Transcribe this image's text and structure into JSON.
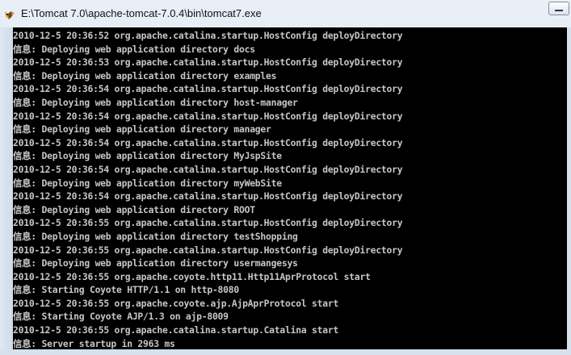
{
  "window": {
    "title": "E:\\Tomcat 7.0\\apache-tomcat-7.0.4\\bin\\tomcat7.exe",
    "icon": "tomcat-icon"
  },
  "console": {
    "lines": [
      "2010-12-5 20:36:52 org.apache.catalina.startup.HostConfig deployDirectory",
      "信息: Deploying web application directory docs",
      "2010-12-5 20:36:53 org.apache.catalina.startup.HostConfig deployDirectory",
      "信息: Deploying web application directory examples",
      "2010-12-5 20:36:54 org.apache.catalina.startup.HostConfig deployDirectory",
      "信息: Deploying web application directory host-manager",
      "2010-12-5 20:36:54 org.apache.catalina.startup.HostConfig deployDirectory",
      "信息: Deploying web application directory manager",
      "2010-12-5 20:36:54 org.apache.catalina.startup.HostConfig deployDirectory",
      "信息: Deploying web application directory MyJspSite",
      "2010-12-5 20:36:54 org.apache.catalina.startup.HostConfig deployDirectory",
      "信息: Deploying web application directory myWebSite",
      "2010-12-5 20:36:54 org.apache.catalina.startup.HostConfig deployDirectory",
      "信息: Deploying web application directory ROOT",
      "2010-12-5 20:36:55 org.apache.catalina.startup.HostConfig deployDirectory",
      "信息: Deploying web application directory testShopping",
      "2010-12-5 20:36:55 org.apache.catalina.startup.HostConfig deployDirectory",
      "信息: Deploying web application directory usermangesys",
      "2010-12-5 20:36:55 org.apache.coyote.http11.Http11AprProtocol start",
      "信息: Starting Coyote HTTP/1.1 on http-8080",
      "2010-12-5 20:36:55 org.apache.coyote.ajp.AjpAprProtocol start",
      "信息: Starting Coyote AJP/1.3 on ajp-8009",
      "2010-12-5 20:36:55 org.apache.catalina.startup.Catalina start",
      "信息: Server startup in 2963 ms"
    ]
  }
}
